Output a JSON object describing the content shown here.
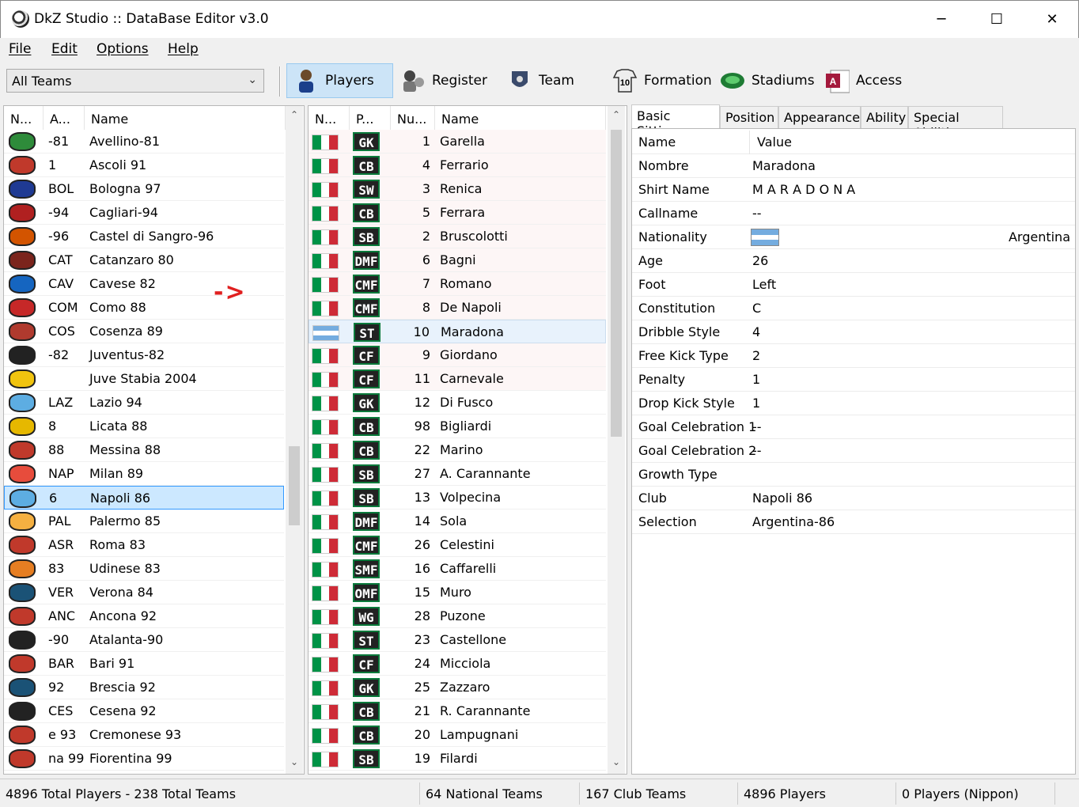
{
  "window": {
    "title": "DkZ Studio :: DataBase Editor v3.0",
    "minimize": "─",
    "maximize": "☐",
    "close": "✕"
  },
  "menu": [
    "File",
    "Edit",
    "Options",
    "Help"
  ],
  "toolbar": {
    "team_filter": "All Teams",
    "buttons": [
      "Players",
      "Register",
      "Team",
      "Formation",
      "Stadiums",
      "Access"
    ],
    "active": "Players"
  },
  "teams": {
    "headers": [
      "N...",
      "A...",
      "Name"
    ],
    "rows": [
      [
        "-81",
        "Avellino-81"
      ],
      [
        "1",
        "Ascoli 91"
      ],
      [
        "BOL",
        "Bologna 97"
      ],
      [
        "-94",
        "Cagliari-94"
      ],
      [
        "-96",
        "Castel di Sangro-96"
      ],
      [
        "CAT",
        "Catanzaro 80"
      ],
      [
        "CAV",
        "Cavese 82"
      ],
      [
        "COM",
        "Como 88"
      ],
      [
        "COS",
        "Cosenza 89"
      ],
      [
        "-82",
        "Juventus-82"
      ],
      [
        "",
        "Juve Stabia 2004"
      ],
      [
        "LAZ",
        "Lazio 94"
      ],
      [
        "8",
        "Licata 88"
      ],
      [
        "88",
        "Messina 88"
      ],
      [
        "NAP",
        "Milan 89"
      ],
      [
        "6",
        "Napoli 86"
      ],
      [
        "PAL",
        "Palermo 85"
      ],
      [
        "ASR",
        "Roma 83"
      ],
      [
        "83",
        "Udinese 83"
      ],
      [
        "VER",
        "Verona 84"
      ],
      [
        "ANC",
        "Ancona 92"
      ],
      [
        "-90",
        "Atalanta-90"
      ],
      [
        "BAR",
        "Bari 91"
      ],
      [
        "92",
        "Brescia 92"
      ],
      [
        "CES",
        "Cesena 92"
      ],
      [
        "e 93",
        "Cremonese 93"
      ],
      [
        "na 99",
        "Fiorentina 99"
      ]
    ],
    "selected_index": 15,
    "crest_colors": [
      "#2e8b3a",
      "#c0392b",
      "#1f3a93",
      "#b02020",
      "#d35400",
      "#7b241c",
      "#1565c0",
      "#c62828",
      "#b03a2e",
      "#222222",
      "#f1c40f",
      "#5dade2",
      "#e6b800",
      "#c0392b",
      "#e74c3c",
      "#5dade2",
      "#f5b041",
      "#c0392b",
      "#e67e22",
      "#1a5276",
      "#c0392b",
      "#222222",
      "#c0392b",
      "#1a5276",
      "#222222",
      "#c0392b",
      "#c0392b"
    ]
  },
  "arrow_annotation": "->",
  "players": {
    "headers": [
      "N...",
      "P...",
      "Nu...",
      "Name"
    ],
    "rows": [
      [
        "GK",
        "1",
        "Garella"
      ],
      [
        "CB",
        "4",
        "Ferrario"
      ],
      [
        "SW",
        "3",
        "Renica"
      ],
      [
        "CB",
        "5",
        "Ferrara"
      ],
      [
        "SB",
        "2",
        "Bruscolotti"
      ],
      [
        "DMF",
        "6",
        "Bagni"
      ],
      [
        "CMF",
        "7",
        "Romano"
      ],
      [
        "CMF",
        "8",
        "De Napoli"
      ],
      [
        "ST",
        "10",
        "Maradona"
      ],
      [
        "CF",
        "9",
        "Giordano"
      ],
      [
        "CF",
        "11",
        "Carnevale"
      ],
      [
        "GK",
        "12",
        "Di Fusco"
      ],
      [
        "CB",
        "98",
        "Bigliardi"
      ],
      [
        "CB",
        "22",
        "Marino"
      ],
      [
        "SB",
        "27",
        "A. Carannante"
      ],
      [
        "SB",
        "13",
        "Volpecina"
      ],
      [
        "DMF",
        "14",
        "Sola"
      ],
      [
        "CMF",
        "26",
        "Celestini"
      ],
      [
        "SMF",
        "16",
        "Caffarelli"
      ],
      [
        "OMF",
        "15",
        "Muro"
      ],
      [
        "WG",
        "28",
        "Puzone"
      ],
      [
        "ST",
        "23",
        "Castellone"
      ],
      [
        "CF",
        "24",
        "Micciola"
      ],
      [
        "GK",
        "25",
        "Zazzaro"
      ],
      [
        "CB",
        "21",
        "R. Carannante"
      ],
      [
        "CB",
        "20",
        "Lampugnani"
      ],
      [
        "SB",
        "19",
        "Filardi"
      ]
    ],
    "selected_index": 8,
    "selected_nationality": "argentina"
  },
  "details": {
    "tabs": [
      "Basic Sittings",
      "Position",
      "Appearance",
      "Ability",
      "Special Abilities"
    ],
    "active_tab": "Basic Sittings",
    "headers": [
      "Name",
      "Value"
    ],
    "rows": [
      [
        "Nombre",
        "Maradona"
      ],
      [
        "Shirt Name",
        "M A R A D O N A"
      ],
      [
        "Callname",
        "--"
      ],
      [
        "Nationality",
        "Argentina"
      ],
      [
        "Age",
        "26"
      ],
      [
        "Foot",
        "Left"
      ],
      [
        "Constitution",
        "C"
      ],
      [
        "Dribble Style",
        "4"
      ],
      [
        "Free Kick Type",
        "2"
      ],
      [
        "Penalty",
        "1"
      ],
      [
        "Drop Kick Style",
        "1"
      ],
      [
        "Goal Celebration 1",
        "--"
      ],
      [
        "Goal Celebration 2",
        "--"
      ],
      [
        "Growth Type",
        ""
      ],
      [
        "Club",
        "Napoli 86"
      ],
      [
        "Selection",
        "Argentina-86"
      ]
    ]
  },
  "status": [
    "4896 Total Players  -  238 Total Teams",
    "64 National Teams",
    "167 Club Teams",
    "4896 Players",
    "0 Players (Nippon)"
  ]
}
